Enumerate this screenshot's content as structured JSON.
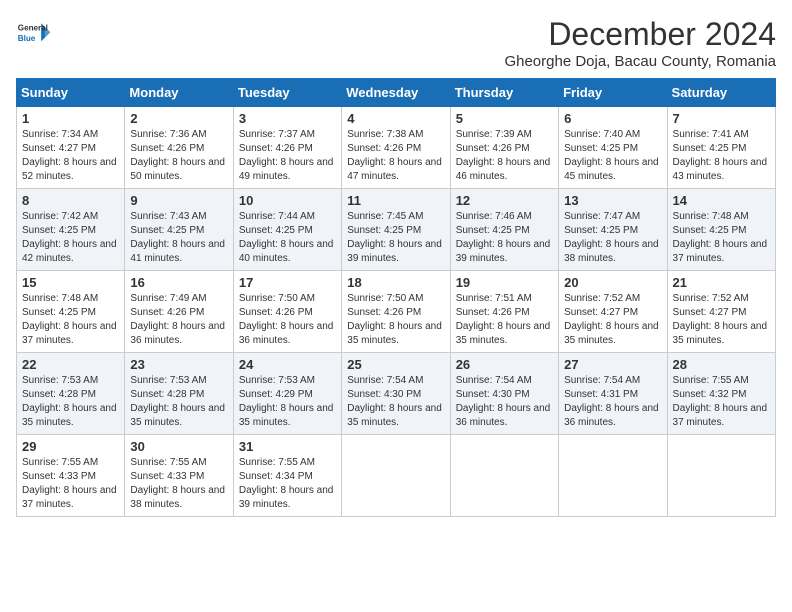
{
  "logo": {
    "line1": "General",
    "line2": "Blue"
  },
  "title": "December 2024",
  "location": "Gheorghe Doja, Bacau County, Romania",
  "days_header": [
    "Sunday",
    "Monday",
    "Tuesday",
    "Wednesday",
    "Thursday",
    "Friday",
    "Saturday"
  ],
  "weeks": [
    [
      {
        "day": "1",
        "sunrise": "7:34 AM",
        "sunset": "4:27 PM",
        "daylight": "8 hours and 52 minutes."
      },
      {
        "day": "2",
        "sunrise": "7:36 AM",
        "sunset": "4:26 PM",
        "daylight": "8 hours and 50 minutes."
      },
      {
        "day": "3",
        "sunrise": "7:37 AM",
        "sunset": "4:26 PM",
        "daylight": "8 hours and 49 minutes."
      },
      {
        "day": "4",
        "sunrise": "7:38 AM",
        "sunset": "4:26 PM",
        "daylight": "8 hours and 47 minutes."
      },
      {
        "day": "5",
        "sunrise": "7:39 AM",
        "sunset": "4:26 PM",
        "daylight": "8 hours and 46 minutes."
      },
      {
        "day": "6",
        "sunrise": "7:40 AM",
        "sunset": "4:25 PM",
        "daylight": "8 hours and 45 minutes."
      },
      {
        "day": "7",
        "sunrise": "7:41 AM",
        "sunset": "4:25 PM",
        "daylight": "8 hours and 43 minutes."
      }
    ],
    [
      {
        "day": "8",
        "sunrise": "7:42 AM",
        "sunset": "4:25 PM",
        "daylight": "8 hours and 42 minutes."
      },
      {
        "day": "9",
        "sunrise": "7:43 AM",
        "sunset": "4:25 PM",
        "daylight": "8 hours and 41 minutes."
      },
      {
        "day": "10",
        "sunrise": "7:44 AM",
        "sunset": "4:25 PM",
        "daylight": "8 hours and 40 minutes."
      },
      {
        "day": "11",
        "sunrise": "7:45 AM",
        "sunset": "4:25 PM",
        "daylight": "8 hours and 39 minutes."
      },
      {
        "day": "12",
        "sunrise": "7:46 AM",
        "sunset": "4:25 PM",
        "daylight": "8 hours and 39 minutes."
      },
      {
        "day": "13",
        "sunrise": "7:47 AM",
        "sunset": "4:25 PM",
        "daylight": "8 hours and 38 minutes."
      },
      {
        "day": "14",
        "sunrise": "7:48 AM",
        "sunset": "4:25 PM",
        "daylight": "8 hours and 37 minutes."
      }
    ],
    [
      {
        "day": "15",
        "sunrise": "7:48 AM",
        "sunset": "4:25 PM",
        "daylight": "8 hours and 37 minutes."
      },
      {
        "day": "16",
        "sunrise": "7:49 AM",
        "sunset": "4:26 PM",
        "daylight": "8 hours and 36 minutes."
      },
      {
        "day": "17",
        "sunrise": "7:50 AM",
        "sunset": "4:26 PM",
        "daylight": "8 hours and 36 minutes."
      },
      {
        "day": "18",
        "sunrise": "7:50 AM",
        "sunset": "4:26 PM",
        "daylight": "8 hours and 35 minutes."
      },
      {
        "day": "19",
        "sunrise": "7:51 AM",
        "sunset": "4:26 PM",
        "daylight": "8 hours and 35 minutes."
      },
      {
        "day": "20",
        "sunrise": "7:52 AM",
        "sunset": "4:27 PM",
        "daylight": "8 hours and 35 minutes."
      },
      {
        "day": "21",
        "sunrise": "7:52 AM",
        "sunset": "4:27 PM",
        "daylight": "8 hours and 35 minutes."
      }
    ],
    [
      {
        "day": "22",
        "sunrise": "7:53 AM",
        "sunset": "4:28 PM",
        "daylight": "8 hours and 35 minutes."
      },
      {
        "day": "23",
        "sunrise": "7:53 AM",
        "sunset": "4:28 PM",
        "daylight": "8 hours and 35 minutes."
      },
      {
        "day": "24",
        "sunrise": "7:53 AM",
        "sunset": "4:29 PM",
        "daylight": "8 hours and 35 minutes."
      },
      {
        "day": "25",
        "sunrise": "7:54 AM",
        "sunset": "4:30 PM",
        "daylight": "8 hours and 35 minutes."
      },
      {
        "day": "26",
        "sunrise": "7:54 AM",
        "sunset": "4:30 PM",
        "daylight": "8 hours and 36 minutes."
      },
      {
        "day": "27",
        "sunrise": "7:54 AM",
        "sunset": "4:31 PM",
        "daylight": "8 hours and 36 minutes."
      },
      {
        "day": "28",
        "sunrise": "7:55 AM",
        "sunset": "4:32 PM",
        "daylight": "8 hours and 37 minutes."
      }
    ],
    [
      {
        "day": "29",
        "sunrise": "7:55 AM",
        "sunset": "4:33 PM",
        "daylight": "8 hours and 37 minutes."
      },
      {
        "day": "30",
        "sunrise": "7:55 AM",
        "sunset": "4:33 PM",
        "daylight": "8 hours and 38 minutes."
      },
      {
        "day": "31",
        "sunrise": "7:55 AM",
        "sunset": "4:34 PM",
        "daylight": "8 hours and 39 minutes."
      },
      null,
      null,
      null,
      null
    ]
  ]
}
